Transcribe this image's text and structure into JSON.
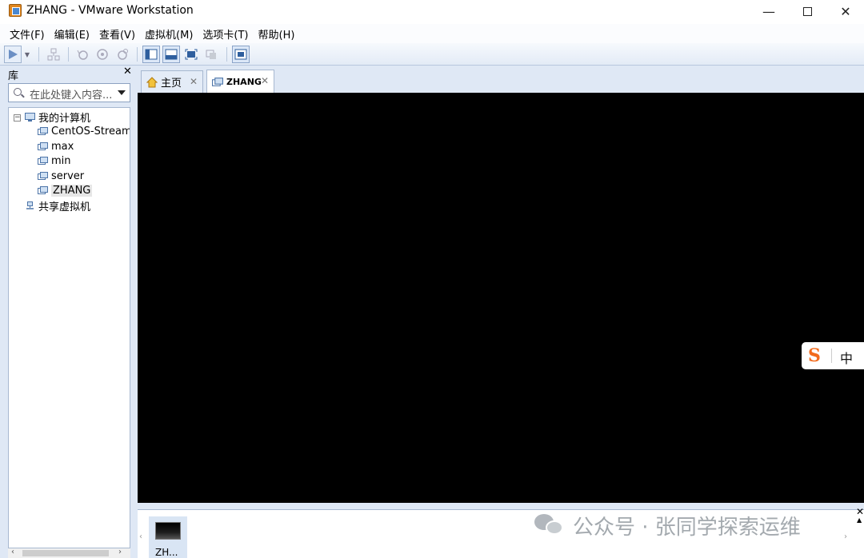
{
  "window": {
    "title": "ZHANG - VMware Workstation",
    "minimize": "—",
    "close": "✕"
  },
  "menu": [
    "文件(F)",
    "编辑(E)",
    "查看(V)",
    "虚拟机(M)",
    "选项卡(T)",
    "帮助(H)"
  ],
  "library": {
    "title": "库",
    "close": "✕",
    "search_placeholder": "在此处键入内容...",
    "tree": {
      "root_toggle": "−",
      "root": "我的计算机",
      "vms": [
        "CentOS-Stream-",
        "max",
        "min",
        "server",
        "ZHANG"
      ],
      "selected": "ZHANG",
      "shared": "共享虚拟机"
    },
    "scroll_left": "‹",
    "scroll_right": "›"
  },
  "tabs": [
    {
      "label": "主页",
      "close": "✕"
    },
    {
      "label": "ZHANG",
      "close": "✕"
    }
  ],
  "ime": {
    "logo": "S",
    "mode": "中"
  },
  "thumbnail_bar": {
    "items": [
      {
        "label": "ZH..."
      }
    ],
    "close": "✕",
    "arrow_up": "▲",
    "scroll_left": "‹",
    "scroll_right": "›"
  },
  "watermark": "公众号 · 张同学探索运维",
  "colors": {
    "accent": "#3b6fb6",
    "vm_screen": "#000000",
    "chrome": "#dfe8f5",
    "ime_logo": "#f26b1d"
  }
}
